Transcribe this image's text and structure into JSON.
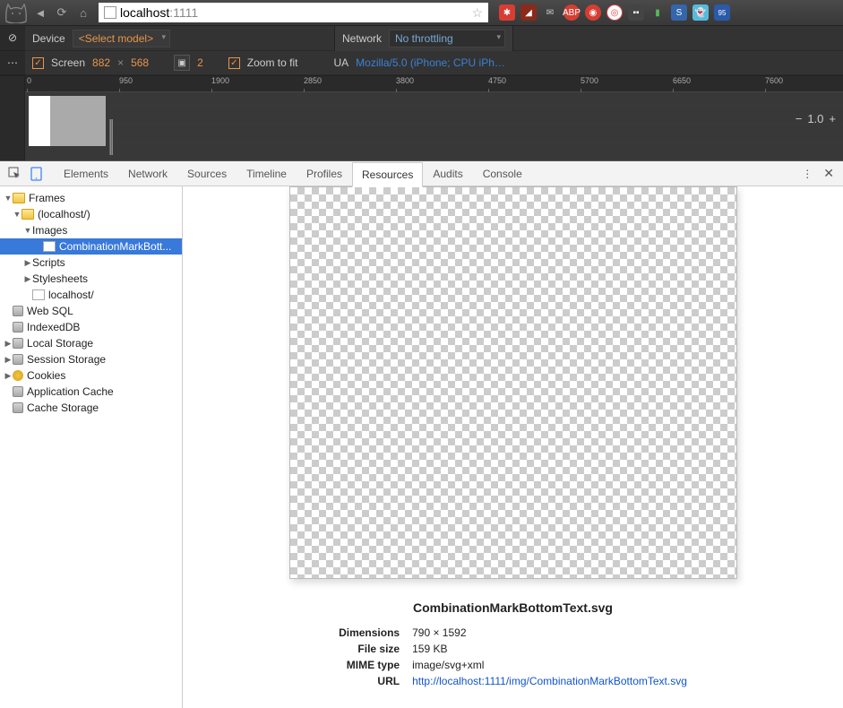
{
  "url": {
    "host": "localhost",
    "rest": ":1111"
  },
  "device": {
    "label": "Device",
    "model_placeholder": "<Select model>",
    "screen_label": "Screen",
    "width": "882",
    "height": "568",
    "dpr": "2",
    "zoom_label": "Zoom to fit",
    "network_label": "Network",
    "throttle": "No throttling",
    "ua_label": "UA",
    "ua_value": "Mozilla/5.0 (iPhone; CPU iPhon..."
  },
  "ruler_ticks": [
    "0",
    "950",
    "1900",
    "2850",
    "3800",
    "4750",
    "5700",
    "6650",
    "7600"
  ],
  "zoom_value": "1.0",
  "tabs": [
    "Elements",
    "Network",
    "Sources",
    "Timeline",
    "Profiles",
    "Resources",
    "Audits",
    "Console"
  ],
  "active_tab": "Resources",
  "tree": {
    "frames": "Frames",
    "localhost": "(localhost/)",
    "images": "Images",
    "img_item": "CombinationMarkBott...",
    "scripts": "Scripts",
    "stylesheets": "Stylesheets",
    "doc": "localhost/",
    "websql": "Web SQL",
    "indexeddb": "IndexedDB",
    "localstorage": "Local Storage",
    "sessionstorage": "Session Storage",
    "cookies": "Cookies",
    "appcache": "Application Cache",
    "cachestorage": "Cache Storage"
  },
  "preview": {
    "filename": "CombinationMarkBottomText.svg",
    "dim_label": "Dimensions",
    "dim_value": "790 × 1592",
    "size_label": "File size",
    "size_value": "159 KB",
    "mime_label": "MIME type",
    "mime_value": "image/svg+xml",
    "url_label": "URL",
    "url_value": "http://localhost:1111/img/CombinationMarkBottomText.svg"
  }
}
